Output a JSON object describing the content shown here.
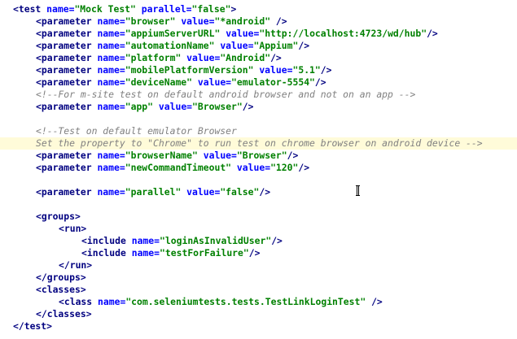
{
  "editor": {
    "highlighted_line": 11,
    "lines": [
      {
        "indent": 0,
        "tokens": [
          {
            "t": "tag",
            "v": "<test "
          },
          {
            "t": "attr",
            "v": "name="
          },
          {
            "t": "str",
            "v": "\"Mock Test\""
          },
          {
            "t": "sp",
            "v": " "
          },
          {
            "t": "attr",
            "v": "parallel="
          },
          {
            "t": "str",
            "v": "\"false\""
          },
          {
            "t": "tag",
            "v": ">"
          }
        ]
      },
      {
        "indent": 1,
        "tokens": [
          {
            "t": "tag",
            "v": "<parameter "
          },
          {
            "t": "attr",
            "v": "name="
          },
          {
            "t": "str",
            "v": "\"browser\""
          },
          {
            "t": "sp",
            "v": " "
          },
          {
            "t": "attr",
            "v": "value="
          },
          {
            "t": "str",
            "v": "\"*android\""
          },
          {
            "t": "sp",
            "v": " "
          },
          {
            "t": "tag",
            "v": "/>"
          }
        ]
      },
      {
        "indent": 1,
        "tokens": [
          {
            "t": "tag",
            "v": "<parameter "
          },
          {
            "t": "attr",
            "v": "name="
          },
          {
            "t": "str",
            "v": "\"appiumServerURL\""
          },
          {
            "t": "sp",
            "v": " "
          },
          {
            "t": "attr",
            "v": "value="
          },
          {
            "t": "str",
            "v": "\"http://localhost:4723/wd/hub\""
          },
          {
            "t": "tag",
            "v": "/>"
          }
        ]
      },
      {
        "indent": 1,
        "tokens": [
          {
            "t": "tag",
            "v": "<parameter "
          },
          {
            "t": "attr",
            "v": "name="
          },
          {
            "t": "str",
            "v": "\"automationName\""
          },
          {
            "t": "sp",
            "v": " "
          },
          {
            "t": "attr",
            "v": "value="
          },
          {
            "t": "str",
            "v": "\"Appium\""
          },
          {
            "t": "tag",
            "v": "/>"
          }
        ]
      },
      {
        "indent": 1,
        "tokens": [
          {
            "t": "tag",
            "v": "<parameter "
          },
          {
            "t": "attr",
            "v": "name="
          },
          {
            "t": "str",
            "v": "\"platform\""
          },
          {
            "t": "sp",
            "v": " "
          },
          {
            "t": "attr",
            "v": "value="
          },
          {
            "t": "str",
            "v": "\"Android\""
          },
          {
            "t": "tag",
            "v": "/>"
          }
        ]
      },
      {
        "indent": 1,
        "tokens": [
          {
            "t": "tag",
            "v": "<parameter "
          },
          {
            "t": "attr",
            "v": "name="
          },
          {
            "t": "str",
            "v": "\"mobilePlatformVersion\""
          },
          {
            "t": "sp",
            "v": " "
          },
          {
            "t": "attr",
            "v": "value="
          },
          {
            "t": "str",
            "v": "\"5.1\""
          },
          {
            "t": "tag",
            "v": "/>"
          }
        ]
      },
      {
        "indent": 1,
        "tokens": [
          {
            "t": "tag",
            "v": "<parameter "
          },
          {
            "t": "attr",
            "v": "name="
          },
          {
            "t": "str",
            "v": "\"deviceName\""
          },
          {
            "t": "sp",
            "v": " "
          },
          {
            "t": "attr",
            "v": "value="
          },
          {
            "t": "str",
            "v": "\"emulator-5554\""
          },
          {
            "t": "tag",
            "v": "/>"
          }
        ]
      },
      {
        "indent": 1,
        "tokens": [
          {
            "t": "cmt",
            "v": "<!--For m-site test on default android browser and not on an app -->"
          }
        ]
      },
      {
        "indent": 1,
        "tokens": [
          {
            "t": "tag",
            "v": "<parameter "
          },
          {
            "t": "attr",
            "v": "name="
          },
          {
            "t": "str",
            "v": "\"app\""
          },
          {
            "t": "sp",
            "v": " "
          },
          {
            "t": "attr",
            "v": "value="
          },
          {
            "t": "str",
            "v": "\"Browser\""
          },
          {
            "t": "tag",
            "v": "/>"
          }
        ]
      },
      {
        "indent": 0,
        "tokens": []
      },
      {
        "indent": 1,
        "tokens": [
          {
            "t": "cmt",
            "v": "<!--Test on default emulator Browser"
          }
        ]
      },
      {
        "indent": 1,
        "tokens": [
          {
            "t": "cmt",
            "v": "Set the property to \"Chrome\" to run test on chrome browser on android device -->"
          }
        ]
      },
      {
        "indent": 1,
        "tokens": [
          {
            "t": "tag",
            "v": "<parameter "
          },
          {
            "t": "attr",
            "v": "name="
          },
          {
            "t": "str",
            "v": "\"browserName\""
          },
          {
            "t": "sp",
            "v": " "
          },
          {
            "t": "attr",
            "v": "value="
          },
          {
            "t": "str",
            "v": "\"Browser\""
          },
          {
            "t": "tag",
            "v": "/>"
          }
        ]
      },
      {
        "indent": 1,
        "tokens": [
          {
            "t": "tag",
            "v": "<parameter "
          },
          {
            "t": "attr",
            "v": "name="
          },
          {
            "t": "str",
            "v": "\"newCommandTimeout\""
          },
          {
            "t": "sp",
            "v": " "
          },
          {
            "t": "attr",
            "v": "value="
          },
          {
            "t": "str",
            "v": "\"120\""
          },
          {
            "t": "tag",
            "v": "/>"
          }
        ]
      },
      {
        "indent": 0,
        "tokens": []
      },
      {
        "indent": 1,
        "tokens": [
          {
            "t": "tag",
            "v": "<parameter "
          },
          {
            "t": "attr",
            "v": "name="
          },
          {
            "t": "str",
            "v": "\"parallel\""
          },
          {
            "t": "sp",
            "v": " "
          },
          {
            "t": "attr",
            "v": "value="
          },
          {
            "t": "str",
            "v": "\"false\""
          },
          {
            "t": "tag",
            "v": "/>"
          }
        ]
      },
      {
        "indent": 0,
        "tokens": []
      },
      {
        "indent": 1,
        "tokens": [
          {
            "t": "tag",
            "v": "<groups>"
          }
        ]
      },
      {
        "indent": 2,
        "tokens": [
          {
            "t": "tag",
            "v": "<run>"
          }
        ]
      },
      {
        "indent": 3,
        "tokens": [
          {
            "t": "tag",
            "v": "<include "
          },
          {
            "t": "attr",
            "v": "name="
          },
          {
            "t": "str",
            "v": "\"loginAsInvalidUser\""
          },
          {
            "t": "tag",
            "v": "/>"
          }
        ]
      },
      {
        "indent": 3,
        "tokens": [
          {
            "t": "tag",
            "v": "<include "
          },
          {
            "t": "attr",
            "v": "name="
          },
          {
            "t": "str",
            "v": "\"testForFailure\""
          },
          {
            "t": "tag",
            "v": "/>"
          }
        ]
      },
      {
        "indent": 2,
        "tokens": [
          {
            "t": "tag",
            "v": "</run>"
          }
        ]
      },
      {
        "indent": 1,
        "tokens": [
          {
            "t": "tag",
            "v": "</groups>"
          }
        ]
      },
      {
        "indent": 1,
        "tokens": [
          {
            "t": "tag",
            "v": "<classes>"
          }
        ]
      },
      {
        "indent": 2,
        "tokens": [
          {
            "t": "tag",
            "v": "<class "
          },
          {
            "t": "attr",
            "v": "name="
          },
          {
            "t": "str",
            "v": "\"com.seleniumtests.tests.TestLinkLoginTest\""
          },
          {
            "t": "sp",
            "v": " "
          },
          {
            "t": "tag",
            "v": "/>"
          }
        ]
      },
      {
        "indent": 1,
        "tokens": [
          {
            "t": "tag",
            "v": "</classes>"
          }
        ]
      },
      {
        "indent": 0,
        "tokens": [
          {
            "t": "tag",
            "v": "</test>"
          }
        ]
      }
    ]
  },
  "colors": {
    "tag": "#000080",
    "attribute": "#0000ff",
    "string": "#008000",
    "comment": "#808080",
    "highlight": "#fffbd9"
  },
  "cursor_icon": "text-cursor-icon"
}
